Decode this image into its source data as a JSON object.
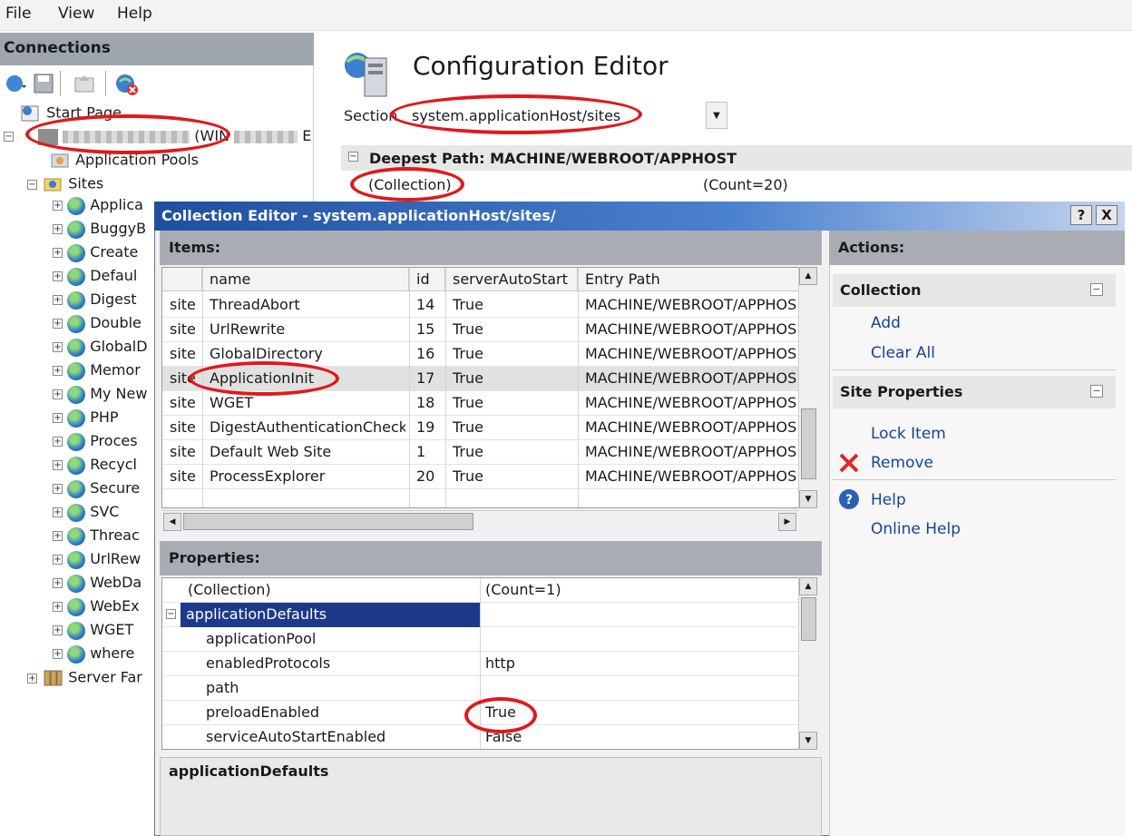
{
  "menu": [
    "File",
    "View",
    "Help"
  ],
  "connections": {
    "header": "Connections",
    "tree": {
      "start_page": "Start Page",
      "server_suffix": "(WIN",
      "app_pools": "Application Pools",
      "sites_label": "Sites",
      "sites": [
        "Applica",
        "BuggyB",
        "Create",
        "Defaul",
        "Digest",
        "Double",
        "GlobalD",
        "Memor",
        "My New",
        "PHP",
        "Proces",
        "Recycl",
        "Secure",
        "SVC",
        "Threac",
        "UrlRew",
        "WebDa",
        "WebEx",
        "WGET",
        "where"
      ],
      "server_farms": "Server Far"
    }
  },
  "config_editor": {
    "title": "Configuration Editor",
    "section_label": "Section:",
    "section_value": "system.applicationHost/sites",
    "deepest_path": "Deepest Path: MACHINE/WEBROOT/APPHOST",
    "collection_label": "(Collection)",
    "collection_count": "(Count=20)"
  },
  "dialog": {
    "title": "Collection Editor - system.applicationHost/sites/",
    "help_btn": "?",
    "close_btn": "X",
    "items_header": "Items:",
    "columns": [
      "name",
      "id",
      "serverAutoStart",
      "Entry Path"
    ],
    "rows": [
      {
        "type": "site",
        "name": "ThreadAbort",
        "id": "14",
        "auto": "True",
        "path": "MACHINE/WEBROOT/APPHOS"
      },
      {
        "type": "site",
        "name": "UrlRewrite",
        "id": "15",
        "auto": "True",
        "path": "MACHINE/WEBROOT/APPHOS"
      },
      {
        "type": "site",
        "name": "GlobalDirectory",
        "id": "16",
        "auto": "True",
        "path": "MACHINE/WEBROOT/APPHOS"
      },
      {
        "type": "site",
        "name": "ApplicationInit",
        "id": "17",
        "auto": "True",
        "path": "MACHINE/WEBROOT/APPHOS"
      },
      {
        "type": "site",
        "name": "WGET",
        "id": "18",
        "auto": "True",
        "path": "MACHINE/WEBROOT/APPHOS"
      },
      {
        "type": "site",
        "name": "DigestAuthenticationCheck",
        "id": "19",
        "auto": "True",
        "path": "MACHINE/WEBROOT/APPHOS"
      },
      {
        "type": "site",
        "name": "Default Web Site",
        "id": "1",
        "auto": "True",
        "path": "MACHINE/WEBROOT/APPHOS"
      },
      {
        "type": "site",
        "name": "ProcessExplorer",
        "id": "20",
        "auto": "True",
        "path": "MACHINE/WEBROOT/APPHOS"
      }
    ],
    "properties_header": "Properties:",
    "properties": [
      {
        "name": "(Collection)",
        "value": "(Count=1)"
      },
      {
        "name": "applicationDefaults",
        "value": ""
      },
      {
        "name": "applicationPool",
        "value": ""
      },
      {
        "name": "enabledProtocols",
        "value": "http"
      },
      {
        "name": "path",
        "value": ""
      },
      {
        "name": "preloadEnabled",
        "value": "True"
      },
      {
        "name": "serviceAutoStartEnabled",
        "value": "False"
      }
    ],
    "description_title": "applicationDefaults"
  },
  "actions": {
    "header": "Actions:",
    "collection": {
      "title": "Collection",
      "items": [
        "Add",
        "Clear All"
      ]
    },
    "site_properties": {
      "title": "Site Properties",
      "items": [
        "Lock Item",
        "Remove"
      ]
    },
    "help": [
      "Help",
      "Online Help"
    ]
  },
  "colors": {
    "accent": "#1f4f9e",
    "annotation": "#e0191c",
    "link": "#14449a",
    "selection": "#1d3a8a"
  }
}
